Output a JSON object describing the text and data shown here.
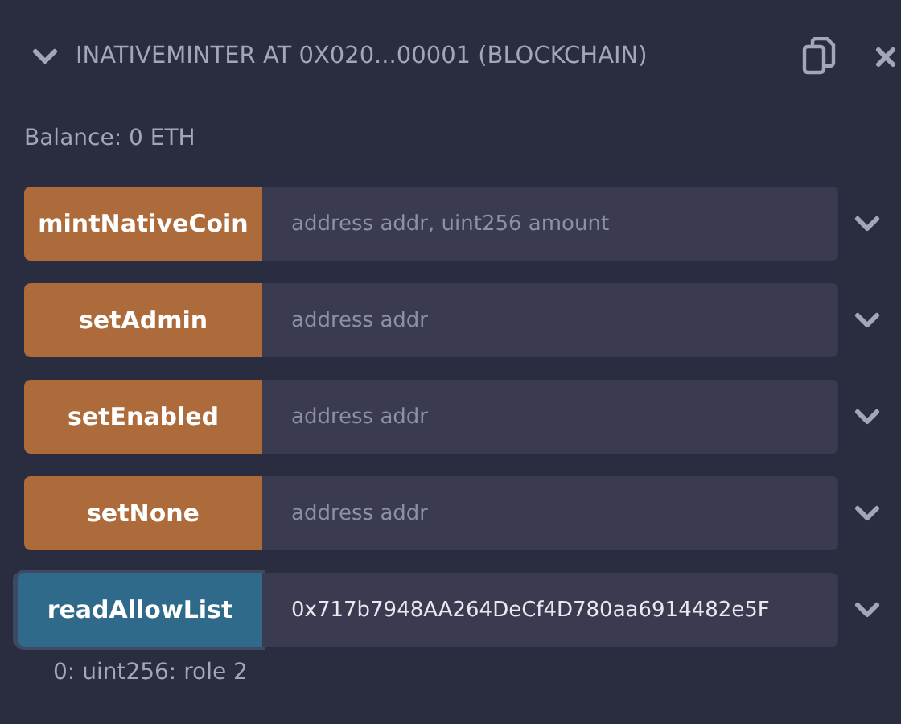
{
  "header": {
    "expanded": true,
    "title": "INATIVEMINTER AT 0X020...00001 (BLOCKCHAIN)"
  },
  "balance": "Balance: 0 ETH",
  "functions": [
    {
      "name": "mintNativeCoin",
      "kind": "transact",
      "placeholder": "address addr, uint256 amount"
    },
    {
      "name": "setAdmin",
      "kind": "transact",
      "placeholder": "address addr"
    },
    {
      "name": "setEnabled",
      "kind": "transact",
      "placeholder": "address addr"
    },
    {
      "name": "setNone",
      "kind": "transact",
      "placeholder": "address addr"
    },
    {
      "name": "readAllowList",
      "kind": "call",
      "value": "0x717b7948AA264DeCf4D780aa6914482e5F",
      "output": "0: uint256: role 2"
    }
  ]
}
